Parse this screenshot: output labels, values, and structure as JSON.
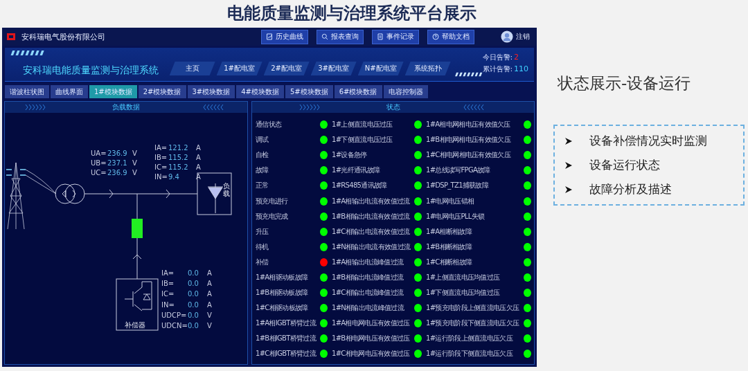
{
  "slide_title": "电能质量监测与治理系统平台展示",
  "top_bar": {
    "company": "安科瑞电气股份有限公司",
    "buttons": [
      {
        "label": "历史曲线",
        "kind": "chart"
      },
      {
        "label": "报表查询",
        "kind": "search"
      },
      {
        "label": "事件记录",
        "kind": "doc"
      },
      {
        "label": "帮助文档",
        "kind": "help"
      }
    ],
    "logout": "注销"
  },
  "header": {
    "system_title": "安科瑞电能质量监测与治理系统",
    "nav": [
      {
        "label": "主页",
        "selected": false
      },
      {
        "label": "1#配电室",
        "selected": false
      },
      {
        "label": "2#配电室",
        "selected": false
      },
      {
        "label": "3#配电室",
        "selected": false
      },
      {
        "label": "N#配电室",
        "selected": false
      },
      {
        "label": "系统拓扑",
        "selected": false
      }
    ],
    "alarms": [
      {
        "label": "今日告警:",
        "value": "2",
        "color": "#ff2020"
      },
      {
        "label": "累计告警:",
        "value": "110",
        "color": "#3fd0ff"
      }
    ]
  },
  "tabs": [
    {
      "label": "谐波柱状图",
      "selected": false
    },
    {
      "label": "曲线界面",
      "selected": false
    },
    {
      "label": "1#模块数据",
      "selected": true
    },
    {
      "label": "2#模块数据",
      "selected": false
    },
    {
      "label": "3#模块数据",
      "selected": false
    },
    {
      "label": "4#模块数据",
      "selected": false
    },
    {
      "label": "5#模块数据",
      "selected": false
    },
    {
      "label": "6#模块数据",
      "selected": false
    },
    {
      "label": "电容控制器",
      "selected": false
    }
  ],
  "load_panel": {
    "title": "负载数据",
    "load_label": "负载",
    "compensator_label": "补偿器",
    "voltages": [
      {
        "label": "UA=",
        "value": "236.9",
        "unit": "V"
      },
      {
        "label": "UB=",
        "value": "237.1",
        "unit": "V"
      },
      {
        "label": "UC=",
        "value": "236.9",
        "unit": "V"
      }
    ],
    "load_currents": [
      {
        "label": "IA=",
        "value": "121.2",
        "unit": "A"
      },
      {
        "label": "IB=",
        "value": "115.2",
        "unit": "A"
      },
      {
        "label": "IC=",
        "value": "115.2",
        "unit": "A"
      },
      {
        "label": "IN=",
        "value": "9.4",
        "unit": "A"
      }
    ],
    "compensator_readings": [
      {
        "label": "IA=",
        "value": "0.0",
        "unit": "A"
      },
      {
        "label": "IB=",
        "value": "0.0",
        "unit": "A"
      },
      {
        "label": "IC=",
        "value": "0.0",
        "unit": "A"
      },
      {
        "label": "IN=",
        "value": "0.0",
        "unit": "A"
      },
      {
        "label": "UDCP=",
        "value": "0.0",
        "unit": "V"
      },
      {
        "label": "UDCN=",
        "value": "0.0",
        "unit": "V"
      }
    ]
  },
  "status_panel": {
    "title": "状态",
    "columns": [
      [
        {
          "label": "通信状态",
          "color": "#00ff00"
        },
        {
          "label": "调试",
          "color": "#00ff00"
        },
        {
          "label": "自检",
          "color": "#00ff00"
        },
        {
          "label": "故障",
          "color": "#00ff00"
        },
        {
          "label": "正常",
          "color": "#00ff00"
        },
        {
          "label": "预充电进行",
          "color": "#00ff00"
        },
        {
          "label": "预充电完成",
          "color": "#00ff00"
        },
        {
          "label": "升压",
          "color": "#00ff00"
        },
        {
          "label": "待机",
          "color": "#00ff00"
        },
        {
          "label": "补偿",
          "color": "#ff0000"
        },
        {
          "label": "1#A相驱动板故障",
          "color": "#00ff00"
        },
        {
          "label": "1#B相驱动板故障",
          "color": "#00ff00"
        },
        {
          "label": "1#C相驱动板故障",
          "color": "#00ff00"
        },
        {
          "label": "1#A相IGBT桥臂过流",
          "color": "#00ff00"
        },
        {
          "label": "1#B相IGBT桥臂过流",
          "color": "#00ff00"
        },
        {
          "label": "1#C相IGBT桥臂过流",
          "color": "#00ff00"
        }
      ],
      [
        {
          "label": "1#上侧直流电压过压",
          "color": "#00ff00"
        },
        {
          "label": "1#下侧直流电压过压",
          "color": "#00ff00"
        },
        {
          "label": "1#设备急停",
          "color": "#00ff00"
        },
        {
          "label": "1#光纤通讯故障",
          "color": "#00ff00"
        },
        {
          "label": "1#RS485通讯故障",
          "color": "#00ff00"
        },
        {
          "label": "1#A相输出电流有效值过流",
          "color": "#00ff00"
        },
        {
          "label": "1#B相输出电流有效值过流",
          "color": "#00ff00"
        },
        {
          "label": "1#C相输出电流有效值过流",
          "color": "#00ff00"
        },
        {
          "label": "1#N相输出电流有效值过流",
          "color": "#00ff00"
        },
        {
          "label": "1#A相输出电流峰值过流",
          "color": "#00ff00"
        },
        {
          "label": "1#B相输出电流峰值过流",
          "color": "#00ff00"
        },
        {
          "label": "1#C相输出电流峰值过流",
          "color": "#00ff00"
        },
        {
          "label": "1#N相输出电流峰值过流",
          "color": "#00ff00"
        },
        {
          "label": "1#A相电网电压有效值过压",
          "color": "#00ff00"
        },
        {
          "label": "1#B相电网电压有效值过压",
          "color": "#00ff00"
        },
        {
          "label": "1#C相电网电压有效值过压",
          "color": "#00ff00"
        }
      ],
      [
        {
          "label": "1#A相电网相电压有效值欠压",
          "color": "#00ff00"
        },
        {
          "label": "1#B相电网相电压有效值欠压",
          "color": "#00ff00"
        },
        {
          "label": "1#C相电网相电压有效值欠压",
          "color": "#00ff00"
        },
        {
          "label": "1#总线读写FPGA故障",
          "color": "#00ff00"
        },
        {
          "label": "1#DSP_TZ1捕获故障",
          "color": "#00ff00"
        },
        {
          "label": "1#电网电压错相",
          "color": "#00ff00"
        },
        {
          "label": "1#电网电压PLL失锁",
          "color": "#00ff00"
        },
        {
          "label": "1#A相断相故障",
          "color": "#00ff00"
        },
        {
          "label": "1#B相断相故障",
          "color": "#00ff00"
        },
        {
          "label": "1#C相断相故障",
          "color": "#00ff00"
        },
        {
          "label": "1#上侧直流电压均值过压",
          "color": "#00ff00"
        },
        {
          "label": "1#下侧直流电压均值过压",
          "color": "#00ff00"
        },
        {
          "label": "1#预充电阶段上侧直流电压欠压",
          "color": "#00ff00"
        },
        {
          "label": "1#预充电阶段下侧直流电压欠压",
          "color": "#00ff00"
        },
        {
          "label": "1#运行阶段上侧直流电压欠压",
          "color": "#00ff00"
        },
        {
          "label": "1#运行阶段下侧直流电压欠压",
          "color": "#00ff00"
        }
      ]
    ]
  },
  "side_notes": {
    "heading": "状态展示-设备运行",
    "bullets": [
      "设备补偿情况实时监测",
      "设备运行状态",
      "故障分析及描述"
    ]
  }
}
